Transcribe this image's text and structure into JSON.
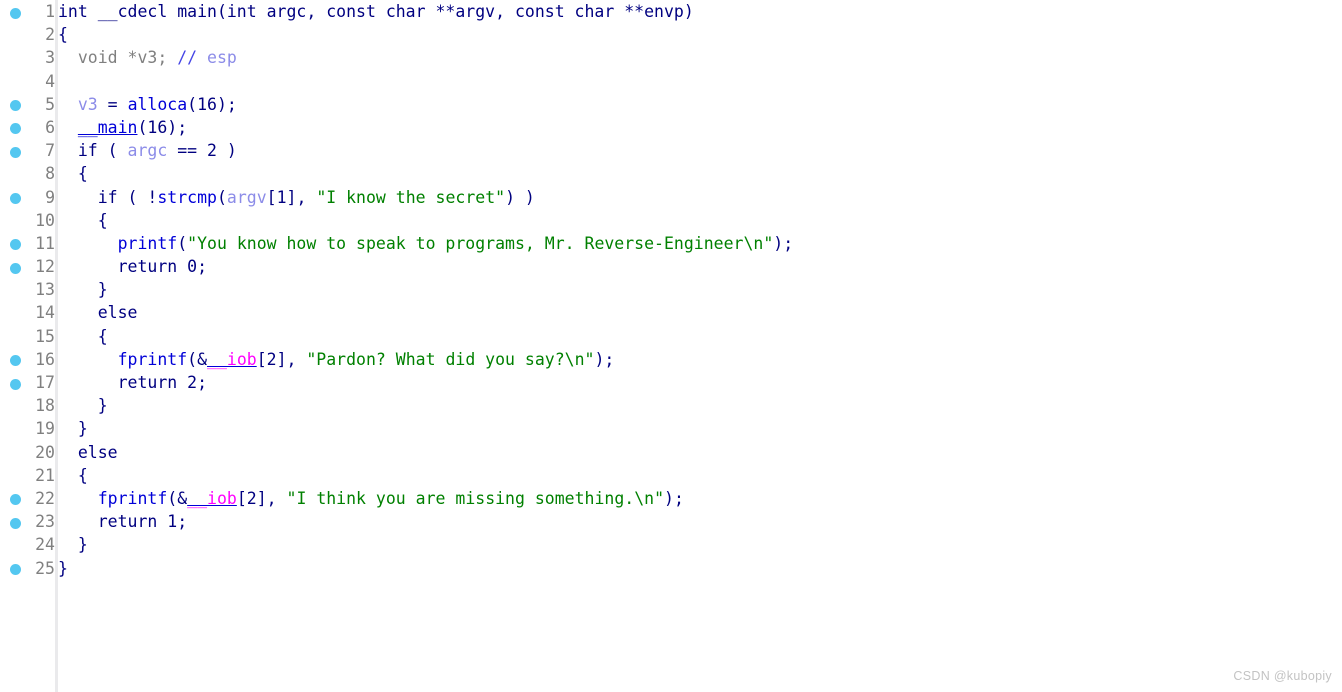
{
  "app": {
    "kind": "decompiler-pseudocode-view",
    "watermark": "CSDN @kubopiy"
  },
  "colors": {
    "background": "#ffffff",
    "gutter_divider": "#eaeaec",
    "line_number": "#808080",
    "breakpoint_dot": "#54c7f0",
    "punctuation": "#000080",
    "keyword": "#000080",
    "function": "#0000d8",
    "variable": "#8c8ce8",
    "string": "#008000",
    "comment": "#808080",
    "comment_marker": "#4646e6",
    "global_symbol": "#ff00ff",
    "watermark": "#c3c3c3"
  },
  "code": {
    "language": "c",
    "lines": [
      {
        "number": "1",
        "breakpoint": true,
        "tokens": [
          {
            "text": "int __cdecl main(int argc, const char **argv, const char **envp)",
            "cls": "t-plain"
          }
        ]
      },
      {
        "number": "2",
        "breakpoint": false,
        "tokens": [
          {
            "text": "{",
            "cls": "t-plain"
          }
        ]
      },
      {
        "number": "3",
        "breakpoint": false,
        "tokens": [
          {
            "text": "  void *v3; ",
            "cls": "t-cmt"
          },
          {
            "text": "// ",
            "cls": "t-cmtmk"
          },
          {
            "text": "esp",
            "cls": "t-var"
          }
        ]
      },
      {
        "number": "4",
        "breakpoint": false,
        "tokens": []
      },
      {
        "number": "5",
        "breakpoint": true,
        "tokens": [
          {
            "text": "  ",
            "cls": "t-plain"
          },
          {
            "text": "v3",
            "cls": "t-var"
          },
          {
            "text": " = ",
            "cls": "t-plain"
          },
          {
            "text": "alloca",
            "cls": "t-fn"
          },
          {
            "text": "(16);",
            "cls": "t-plain"
          }
        ]
      },
      {
        "number": "6",
        "breakpoint": true,
        "tokens": [
          {
            "text": "  ",
            "cls": "t-plain"
          },
          {
            "text": "__main",
            "cls": "t-fn t-ul"
          },
          {
            "text": "(16);",
            "cls": "t-plain"
          }
        ]
      },
      {
        "number": "7",
        "breakpoint": true,
        "tokens": [
          {
            "text": "  if ( ",
            "cls": "t-kw"
          },
          {
            "text": "argc",
            "cls": "t-var"
          },
          {
            "text": " == 2 )",
            "cls": "t-plain"
          }
        ]
      },
      {
        "number": "8",
        "breakpoint": false,
        "tokens": [
          {
            "text": "  {",
            "cls": "t-plain"
          }
        ]
      },
      {
        "number": "9",
        "breakpoint": true,
        "tokens": [
          {
            "text": "    if ( !",
            "cls": "t-kw"
          },
          {
            "text": "strcmp",
            "cls": "t-fn"
          },
          {
            "text": "(",
            "cls": "t-plain"
          },
          {
            "text": "argv",
            "cls": "t-var"
          },
          {
            "text": "[1], ",
            "cls": "t-plain"
          },
          {
            "text": "\"I know the secret\"",
            "cls": "t-str"
          },
          {
            "text": ") )",
            "cls": "t-plain"
          }
        ]
      },
      {
        "number": "10",
        "breakpoint": false,
        "tokens": [
          {
            "text": "    {",
            "cls": "t-plain"
          }
        ]
      },
      {
        "number": "11",
        "breakpoint": true,
        "tokens": [
          {
            "text": "      ",
            "cls": "t-plain"
          },
          {
            "text": "printf",
            "cls": "t-fn"
          },
          {
            "text": "(",
            "cls": "t-plain"
          },
          {
            "text": "\"You know how to speak to programs, Mr. Reverse-Engineer\\n\"",
            "cls": "t-str"
          },
          {
            "text": ");",
            "cls": "t-plain"
          }
        ]
      },
      {
        "number": "12",
        "breakpoint": true,
        "tokens": [
          {
            "text": "      return 0;",
            "cls": "t-kw"
          }
        ]
      },
      {
        "number": "13",
        "breakpoint": false,
        "tokens": [
          {
            "text": "    }",
            "cls": "t-plain"
          }
        ]
      },
      {
        "number": "14",
        "breakpoint": false,
        "tokens": [
          {
            "text": "    else",
            "cls": "t-kw"
          }
        ]
      },
      {
        "number": "15",
        "breakpoint": false,
        "tokens": [
          {
            "text": "    {",
            "cls": "t-plain"
          }
        ]
      },
      {
        "number": "16",
        "breakpoint": true,
        "tokens": [
          {
            "text": "      ",
            "cls": "t-plain"
          },
          {
            "text": "fprintf",
            "cls": "t-fn"
          },
          {
            "text": "(&",
            "cls": "t-plain"
          },
          {
            "text": "__iob",
            "cls": "t-glob t-ul-g"
          },
          {
            "text": "[2], ",
            "cls": "t-plain"
          },
          {
            "text": "\"Pardon? What did you say?\\n\"",
            "cls": "t-str"
          },
          {
            "text": ");",
            "cls": "t-plain"
          }
        ]
      },
      {
        "number": "17",
        "breakpoint": true,
        "tokens": [
          {
            "text": "      return 2;",
            "cls": "t-kw"
          }
        ]
      },
      {
        "number": "18",
        "breakpoint": false,
        "tokens": [
          {
            "text": "    }",
            "cls": "t-plain"
          }
        ]
      },
      {
        "number": "19",
        "breakpoint": false,
        "tokens": [
          {
            "text": "  }",
            "cls": "t-plain"
          }
        ]
      },
      {
        "number": "20",
        "breakpoint": false,
        "tokens": [
          {
            "text": "  else",
            "cls": "t-kw"
          }
        ]
      },
      {
        "number": "21",
        "breakpoint": false,
        "tokens": [
          {
            "text": "  {",
            "cls": "t-plain"
          }
        ]
      },
      {
        "number": "22",
        "breakpoint": true,
        "tokens": [
          {
            "text": "    ",
            "cls": "t-plain"
          },
          {
            "text": "fprintf",
            "cls": "t-fn"
          },
          {
            "text": "(&",
            "cls": "t-plain"
          },
          {
            "text": "__iob",
            "cls": "t-glob t-ul-g"
          },
          {
            "text": "[2], ",
            "cls": "t-plain"
          },
          {
            "text": "\"I think you are missing something.\\n\"",
            "cls": "t-str"
          },
          {
            "text": ");",
            "cls": "t-plain"
          }
        ]
      },
      {
        "number": "23",
        "breakpoint": true,
        "tokens": [
          {
            "text": "    return 1;",
            "cls": "t-kw"
          }
        ]
      },
      {
        "number": "24",
        "breakpoint": false,
        "tokens": [
          {
            "text": "  }",
            "cls": "t-plain"
          }
        ]
      },
      {
        "number": "25",
        "breakpoint": true,
        "tokens": [
          {
            "text": "}",
            "cls": "t-plain"
          }
        ]
      }
    ]
  }
}
